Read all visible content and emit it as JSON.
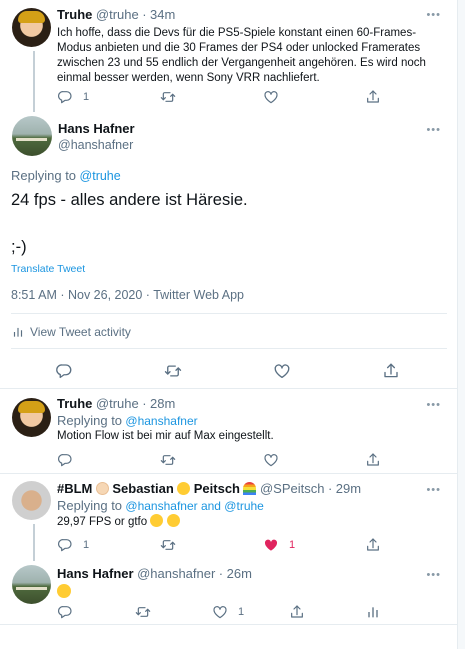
{
  "tweets": [
    {
      "name": "Truhe",
      "handle": "@truhe",
      "time": "34m",
      "text": "Ich hoffe, dass die Devs für die PS5-Spiele konstant einen 60-Frames-Modus anbieten und die 30 Frames der PS4 oder unlocked Framerates zwischen 23 und 55 endlich der Vergangenheit angehören. Es wird noch einmal besser werden, wenn Sony VRR nachliefert.",
      "reply_count": "1"
    },
    {
      "name": "Truhe",
      "handle": "@truhe",
      "time": "28m",
      "replying_label": "Replying to",
      "replying_to": "@hanshafner",
      "text": "Motion Flow ist bei mir auf Max eingestellt."
    },
    {
      "name_parts": [
        "#BLM",
        "Sebastian",
        "Peitsch"
      ],
      "handle": "@SPeitsch",
      "time": "29m",
      "replying_label": "Replying to",
      "replying_to": "@hanshafner and @truhe",
      "text": "29,97 FPS or gtfo",
      "reply_count": "1",
      "like_count": "1"
    },
    {
      "name": "Hans Hafner",
      "handle": "@hanshafner",
      "time": "26m",
      "like_count": "1"
    }
  ],
  "focused": {
    "name": "Hans Hafner",
    "handle": "@hanshafner",
    "replying_label": "Replying to",
    "replying_to": "@truhe",
    "text_line1": "24 fps - alles andere ist Häresie.",
    "text_line2": ";-)",
    "translate": "Translate Tweet",
    "meta": "8:51 AM · Nov 26, 2020 · Twitter Web App",
    "activity": "View Tweet activity"
  },
  "more_glyph": "•••",
  "separator": "·",
  "colors": {
    "accent": "#1b95e0",
    "like": "#e0245e",
    "muted": "#5b7083",
    "border": "#e6ecf0"
  },
  "icons": [
    "reply-icon",
    "retweet-icon",
    "like-icon",
    "share-icon",
    "analytics-icon",
    "more-icon"
  ]
}
